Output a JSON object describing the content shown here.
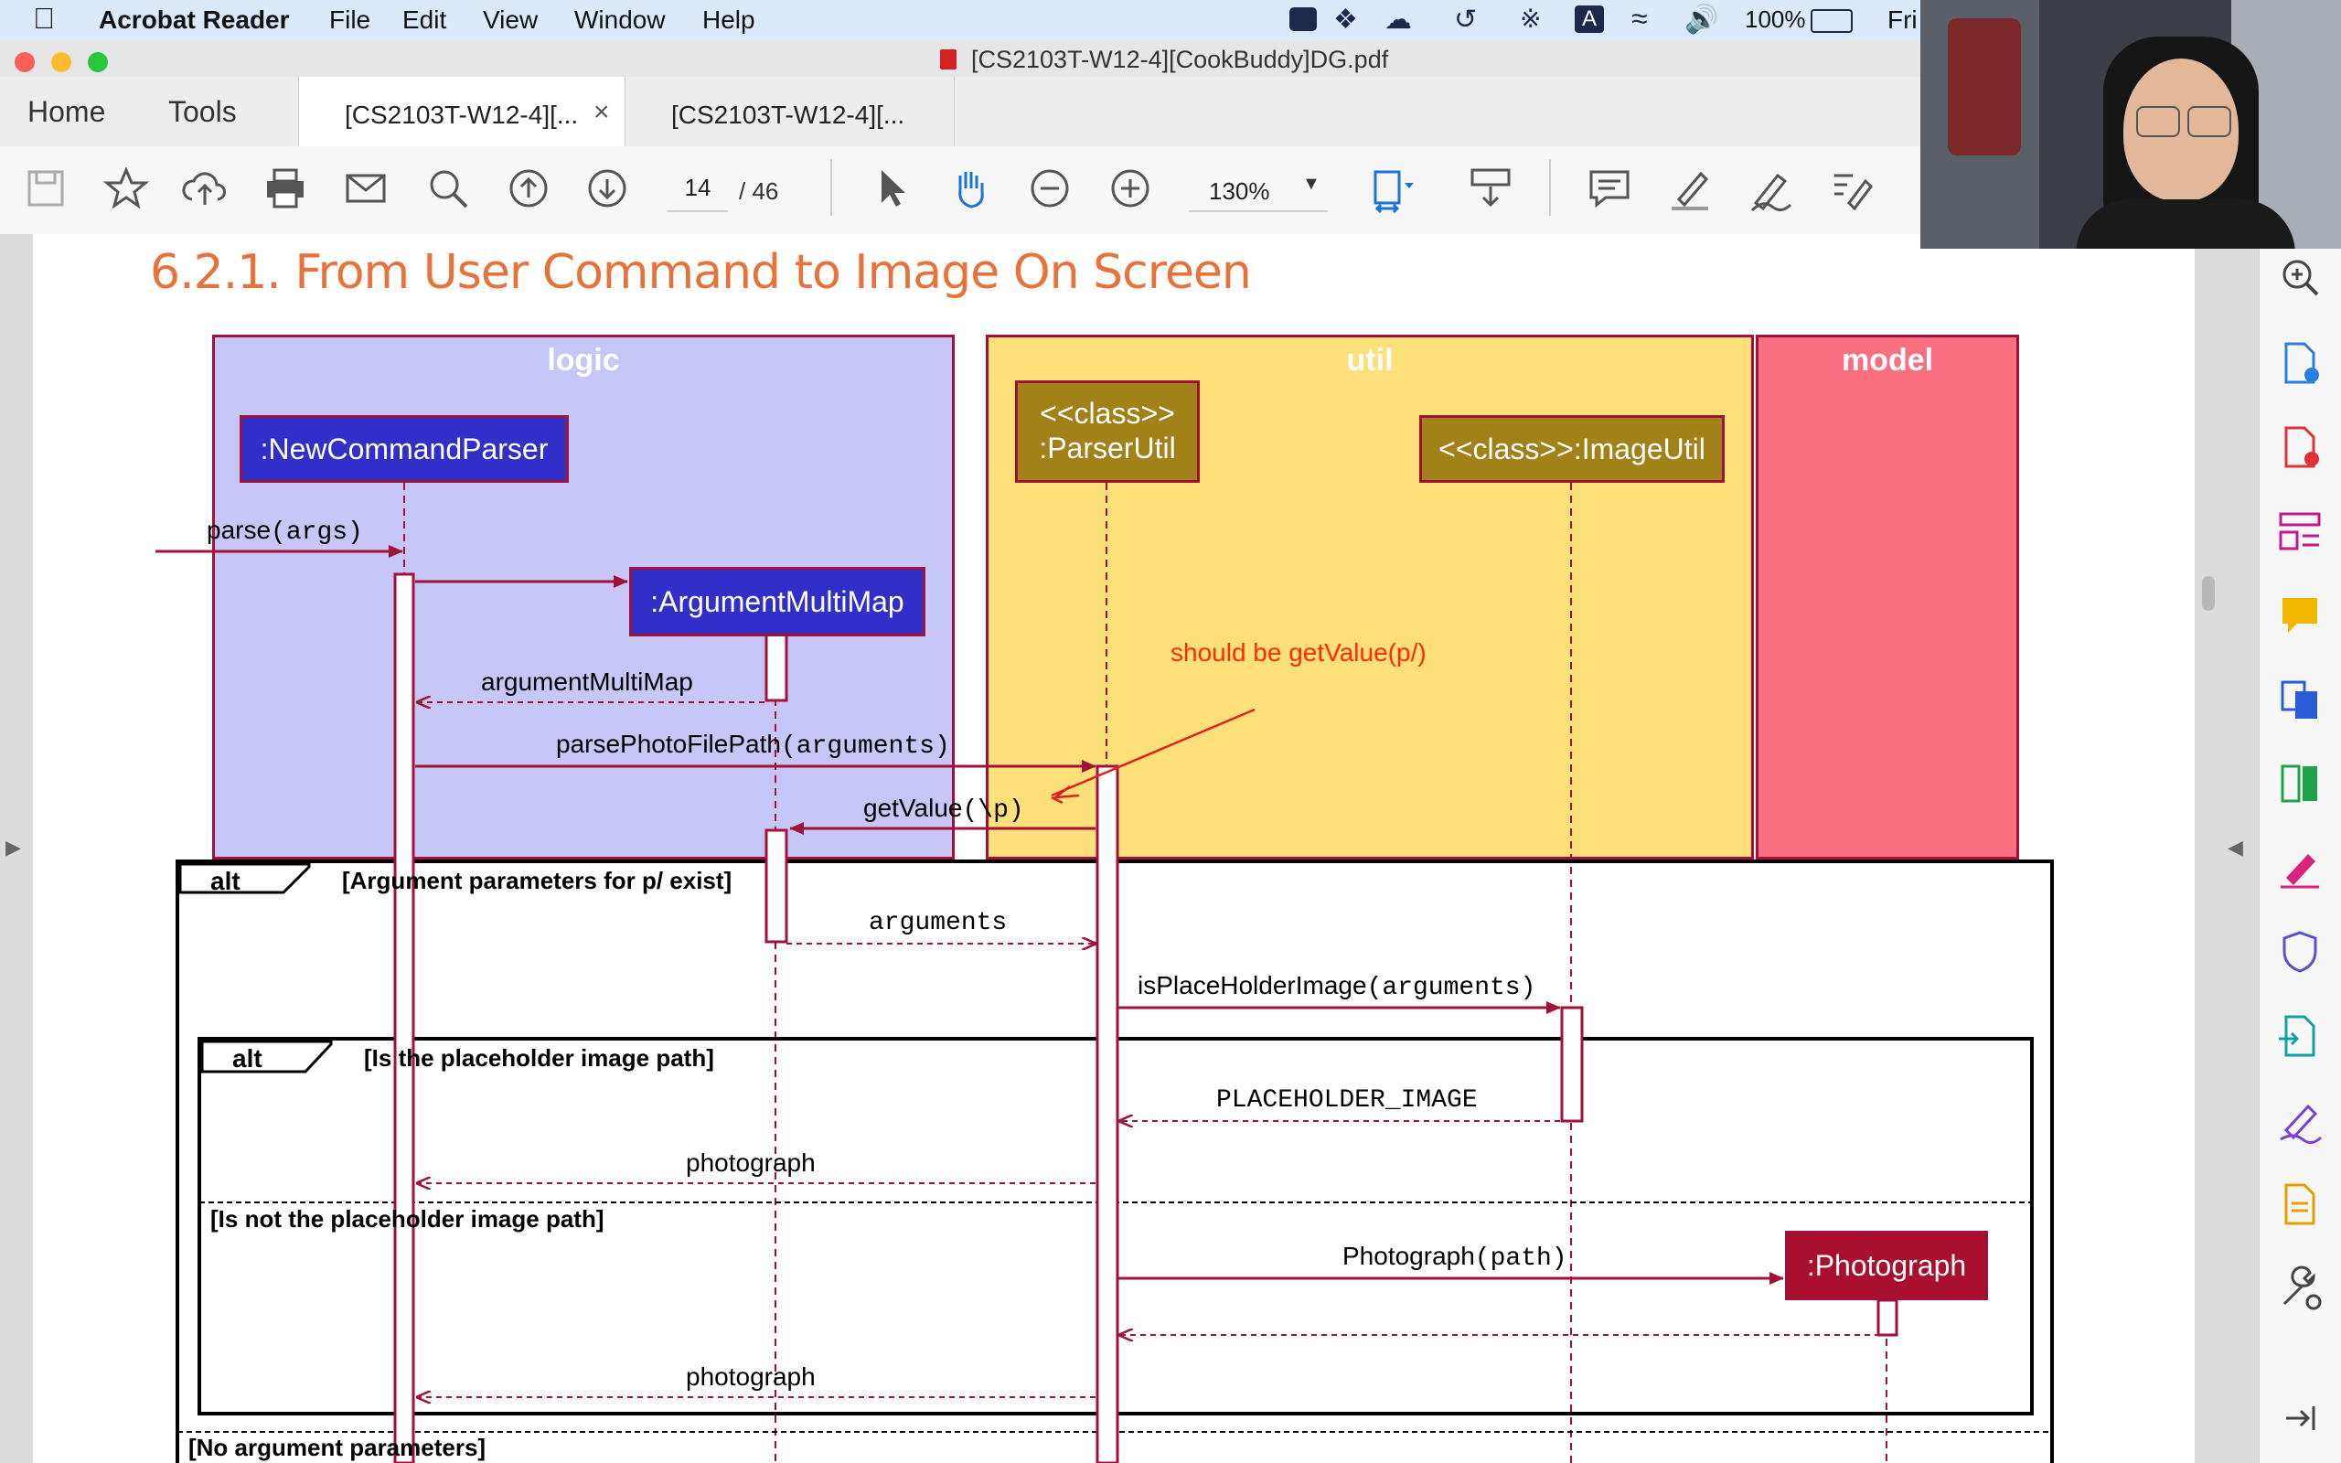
{
  "menubar": {
    "app_name": "Acrobat Reader",
    "menus": [
      "File",
      "Edit",
      "View",
      "Window",
      "Help"
    ],
    "battery": "100%",
    "day": "Fri"
  },
  "window": {
    "title": "[CS2103T-W12-4][CookBuddy]DG.pdf"
  },
  "nav_tabs": {
    "home": "Home",
    "tools": "Tools"
  },
  "doc_tabs": [
    "[CS2103T-W12-4][...",
    "[CS2103T-W12-4][..."
  ],
  "toolbar": {
    "page_current": "14",
    "page_total": "/ 46",
    "zoom": "130%"
  },
  "document": {
    "heading": "6.2.1. From User Command to Image On Screen"
  },
  "diagram": {
    "lanes": {
      "logic": "logic",
      "util": "util",
      "model": "model"
    },
    "participants": {
      "parser": ":NewCommandParser",
      "argmap": ":ArgumentMultiMap",
      "parserutil_l1": "<<class>>",
      "parserutil_l2": ":ParserUtil",
      "imageutil": "<<class>>:ImageUtil",
      "photograph": ":Photograph"
    },
    "messages": {
      "parse_fn": "parse",
      "parse_args": "(args)",
      "argmultimap_ret": "argumentMultiMap",
      "parsephoto_fn": "parsePhotoFilePath",
      "parsephoto_args": "(arguments)",
      "getvalue_fn": "getValue",
      "getvalue_args": "(\\p)",
      "arguments_ret": "arguments",
      "isplaceholder_fn": "isPlaceHolderImage",
      "isplaceholder_args": "(arguments)",
      "placeholder_ret": "PLACEHOLDER_IMAGE",
      "photograph_ret_1": "photograph",
      "photograph_ctor_fn": "Photograph",
      "photograph_ctor_args": "(path)",
      "photograph_ret_2": "photograph"
    },
    "annotation": "should be getValue(p/)",
    "frames": {
      "outer_op": "alt",
      "outer_guard": "[Argument parameters for p/ exist]",
      "inner_op": "alt",
      "inner_guard": "[Is the placeholder image path]",
      "inner_else_guard": "[Is not the placeholder image path]",
      "outer_else_guard": "[No argument parameters]"
    }
  },
  "colors": {
    "logic_lane": "#c7c7f7",
    "util_lane": "#fde07a",
    "model_lane": "#f8707f",
    "participant_blue": "#3030c8",
    "participant_gold": "#a08218",
    "participant_red": "#a8102e",
    "line_red": "#a0123a",
    "heading_orange": "#e8733a"
  }
}
